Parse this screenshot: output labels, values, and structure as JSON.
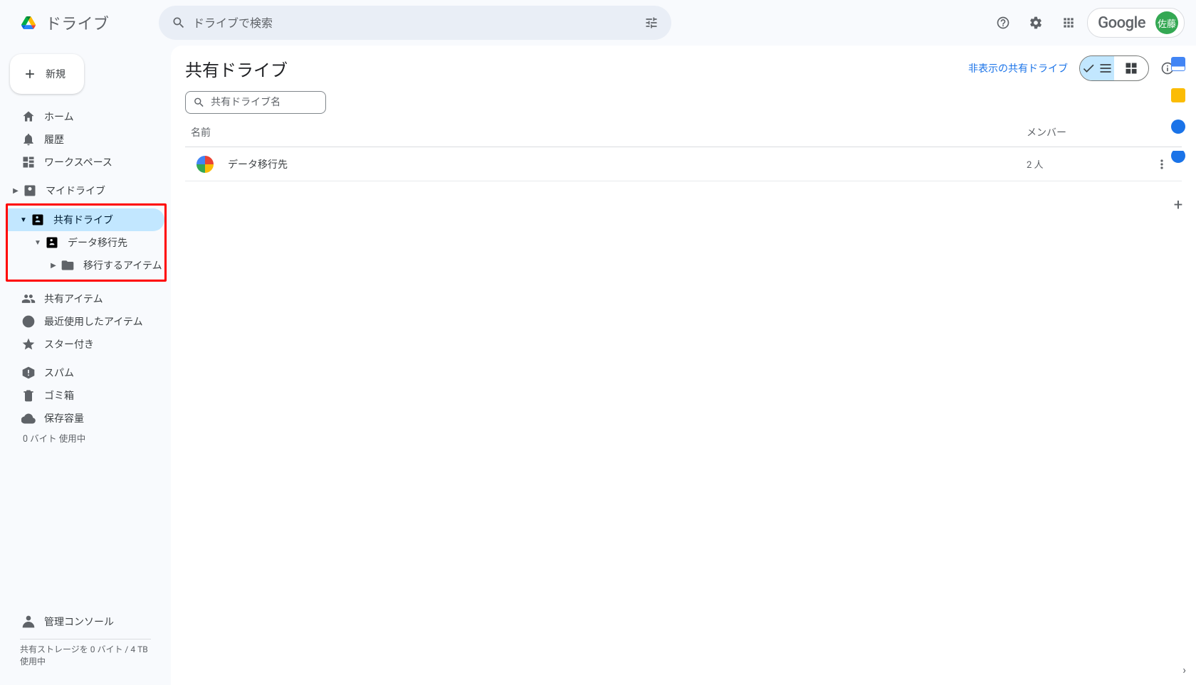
{
  "header": {
    "app_name": "ドライブ",
    "search_placeholder": "ドライブで検索",
    "brand": "Google",
    "avatar_text": "佐藤"
  },
  "sidebar": {
    "new_label": "新規",
    "nav_home": "ホーム",
    "nav_activity": "履歴",
    "nav_workspaces": "ワークスペース",
    "nav_mydrive": "マイドライブ",
    "nav_shared_drives": "共有ドライブ",
    "nav_datadest": "データ移行先",
    "nav_migrate_items": "移行するアイテム",
    "nav_shared_with_me": "共有アイテム",
    "nav_recent": "最近使用したアイテム",
    "nav_starred": "スター付き",
    "nav_spam": "スパム",
    "nav_trash": "ゴミ箱",
    "nav_storage": "保存容量",
    "storage_used": "0 バイト 使用中",
    "admin_console": "管理コンソール",
    "footer_storage": "共有ストレージを 0 バイト / 4 TB 使用中"
  },
  "main": {
    "title": "共有ドライブ",
    "hidden_link": "非表示の共有ドライブ",
    "filter_placeholder": "共有ドライブ名",
    "col_name": "名前",
    "col_members": "メンバー",
    "rows": [
      {
        "name": "データ移行先",
        "members": "2 人"
      }
    ]
  }
}
